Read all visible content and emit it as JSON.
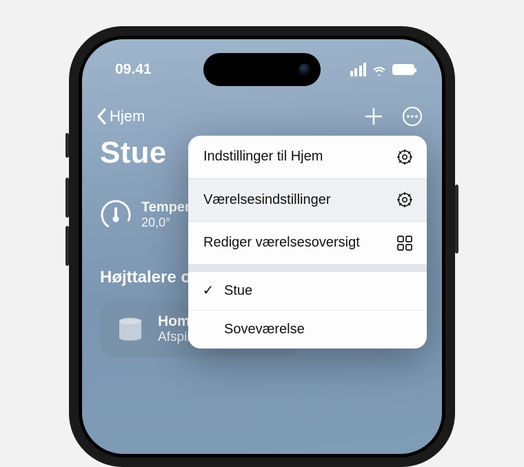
{
  "status": {
    "time": "09.41"
  },
  "nav": {
    "back_label": "Hjem",
    "title": "Stue"
  },
  "temperature": {
    "label": "Temperatu",
    "value": "20,0°"
  },
  "section": {
    "label": "Højttalere og"
  },
  "tile": {
    "title": "HomePo",
    "subtitle": "Afspiller"
  },
  "menu": {
    "home_settings": "Indstillinger til Hjem",
    "room_settings": "Værelsesindstillinger",
    "edit_overview": "Rediger værelsesoversigt",
    "rooms": [
      {
        "label": "Stue",
        "selected": true
      },
      {
        "label": "Soveværelse",
        "selected": false
      }
    ]
  }
}
